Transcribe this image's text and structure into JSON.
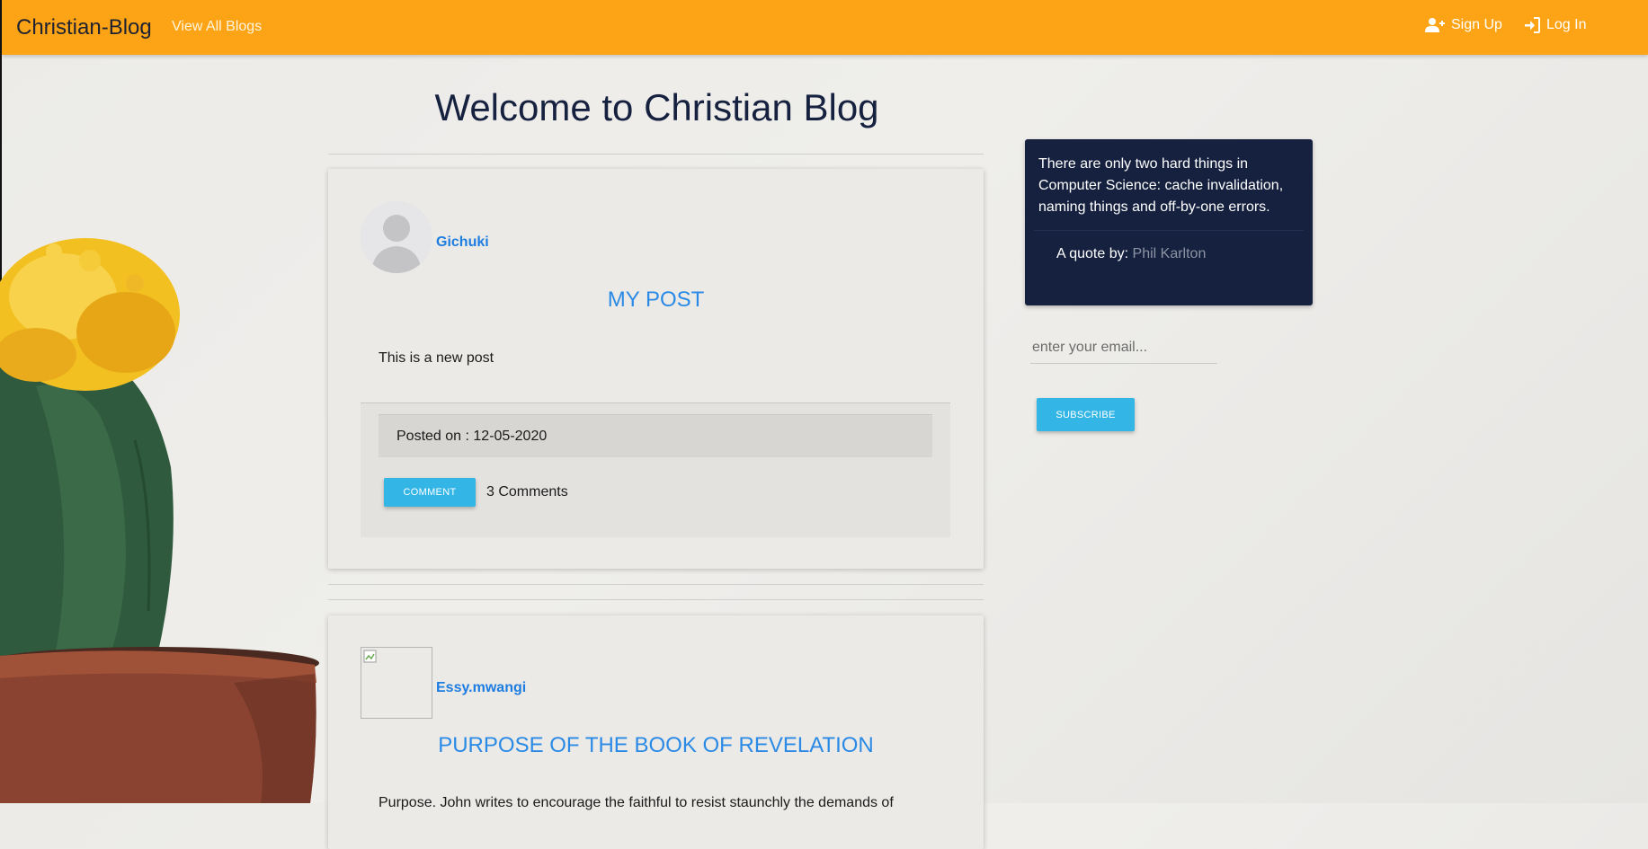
{
  "navbar": {
    "brand": "Christian-Blog",
    "view_all": "View All Blogs",
    "signup": "Sign Up",
    "login": "Log In",
    "signup_icon": "user-plus-icon",
    "login_icon": "sign-in-icon",
    "background": "#fda416"
  },
  "main": {
    "heading": "Welcome to Christian Blog"
  },
  "posts": [
    {
      "author": "Gichuki",
      "title": "MY POST",
      "body": "This is a new post",
      "posted_on": "Posted on : 12-05-2020",
      "comment_button": "COMMENT",
      "comments": "3 Comments"
    },
    {
      "author": "Essy.mwangi",
      "title": "PURPOSE OF THE BOOK OF REVELATION",
      "body": "Purpose. John writes to encourage the faithful to resist staunchly the demands of"
    }
  ],
  "sidebar": {
    "quote_text": "There are only two hard things in Computer Science: cache invalidation, naming things and off-by-one errors.",
    "quote_by_label": "A quote by:",
    "quote_author": "Phil Karlton",
    "email_placeholder": "enter your email...",
    "subscribe_button": "SUBSCRIBE"
  },
  "colors": {
    "accent": "#33b5e5",
    "link": "#1e7de0",
    "quote_bg": "#15213f"
  }
}
